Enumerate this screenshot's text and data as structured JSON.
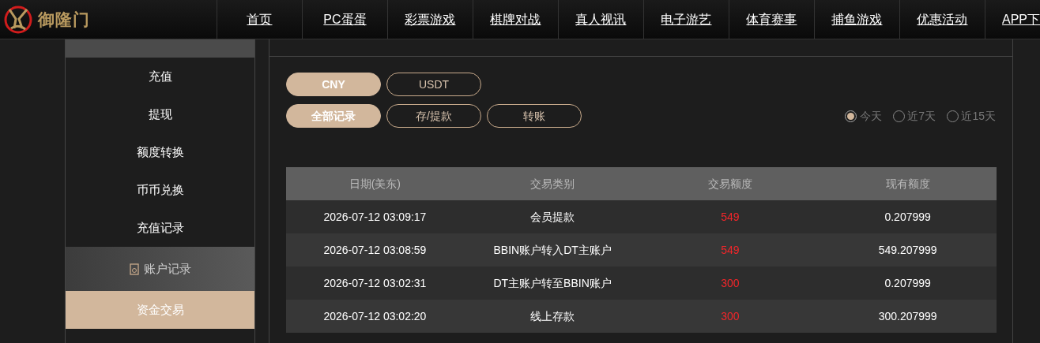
{
  "logo": {
    "text": "御隆门"
  },
  "nav": [
    {
      "label": "首页"
    },
    {
      "label": "PC蛋蛋"
    },
    {
      "label": "彩票游戏"
    },
    {
      "label": "棋牌对战"
    },
    {
      "label": "真人视讯"
    },
    {
      "label": "电子游艺"
    },
    {
      "label": "体育赛事"
    },
    {
      "label": "捕鱼游戏"
    },
    {
      "label": "优惠活动"
    },
    {
      "label": "APP下"
    }
  ],
  "sidebar": {
    "items": [
      {
        "kind": "item",
        "label": "充值",
        "selected": false
      },
      {
        "kind": "item",
        "label": "提现",
        "selected": false
      },
      {
        "kind": "item",
        "label": "额度转换",
        "selected": false
      },
      {
        "kind": "item",
        "label": "币币兑换",
        "selected": false
      },
      {
        "kind": "item",
        "label": "充值记录",
        "selected": false
      },
      {
        "kind": "header",
        "label": "账户记录"
      },
      {
        "kind": "item",
        "label": "资金交易",
        "selected": true
      }
    ]
  },
  "currencies": [
    {
      "label": "CNY",
      "selected": true
    },
    {
      "label": "USDT",
      "selected": false
    }
  ],
  "filters": [
    {
      "label": "全部记录",
      "selected": true
    },
    {
      "label": "存/提款",
      "selected": false
    },
    {
      "label": "转账",
      "selected": false
    }
  ],
  "ranges": [
    {
      "label": "今天",
      "selected": true
    },
    {
      "label": "近7天",
      "selected": false
    },
    {
      "label": "近15天",
      "selected": false
    }
  ],
  "table": {
    "columns": [
      "日期(美东)",
      "交易类别",
      "交易额度",
      "现有额度"
    ],
    "rows": [
      [
        "2026-07-12 03:09:17",
        "会员提款",
        "549",
        "0.207999"
      ],
      [
        "2026-07-12 03:08:59",
        "BBIN账户转入DT主账户",
        "549",
        "549.207999"
      ],
      [
        "2026-07-12 03:02:31",
        "DT主账户转至BBIN账户",
        "300",
        "0.207999"
      ],
      [
        "2026-07-12 03:02:20",
        "线上存款",
        "300",
        "300.207999"
      ]
    ]
  }
}
